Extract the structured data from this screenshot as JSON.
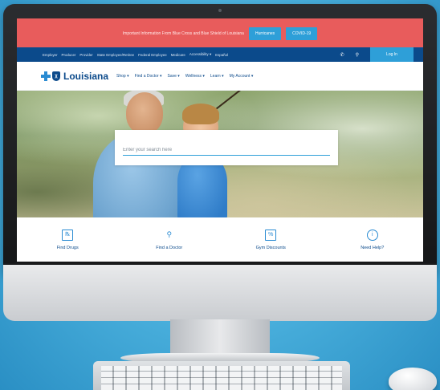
{
  "alert": {
    "text": "Important Information From Blue Cross and Blue Shield of Louisiana",
    "buttons": [
      "Hurricanes",
      "COVID-19"
    ]
  },
  "topnav": {
    "links": [
      "Employer",
      "Producer",
      "Provider",
      "State Employee/Retiree",
      "Federal Employee",
      "Medicare",
      "Accessibility ▾",
      "Español"
    ],
    "login_label": "Log In",
    "icons": [
      "phone-icon",
      "search-icon"
    ]
  },
  "header": {
    "logo_text": "Louisiana",
    "menu": [
      "Shop ▾",
      "Find a Doctor ▾",
      "Save ▾",
      "Wellness ▾",
      "Learn ▾",
      "My Account ▾"
    ]
  },
  "hero": {
    "search_placeholder": "Enter your search here"
  },
  "quicklinks": [
    {
      "label": "Find Drugs",
      "icon": "prescription-icon"
    },
    {
      "label": "Find a Doctor",
      "icon": "magnifier-icon"
    },
    {
      "label": "Gym Discounts",
      "icon": "discount-icon"
    },
    {
      "label": "Need Help?",
      "icon": "info-icon"
    }
  ],
  "colors": {
    "alert_bar": "#e85c5c",
    "accent_button": "#2e9fd8",
    "nav_blue": "#0b4a8b",
    "background": "#4db3df"
  }
}
